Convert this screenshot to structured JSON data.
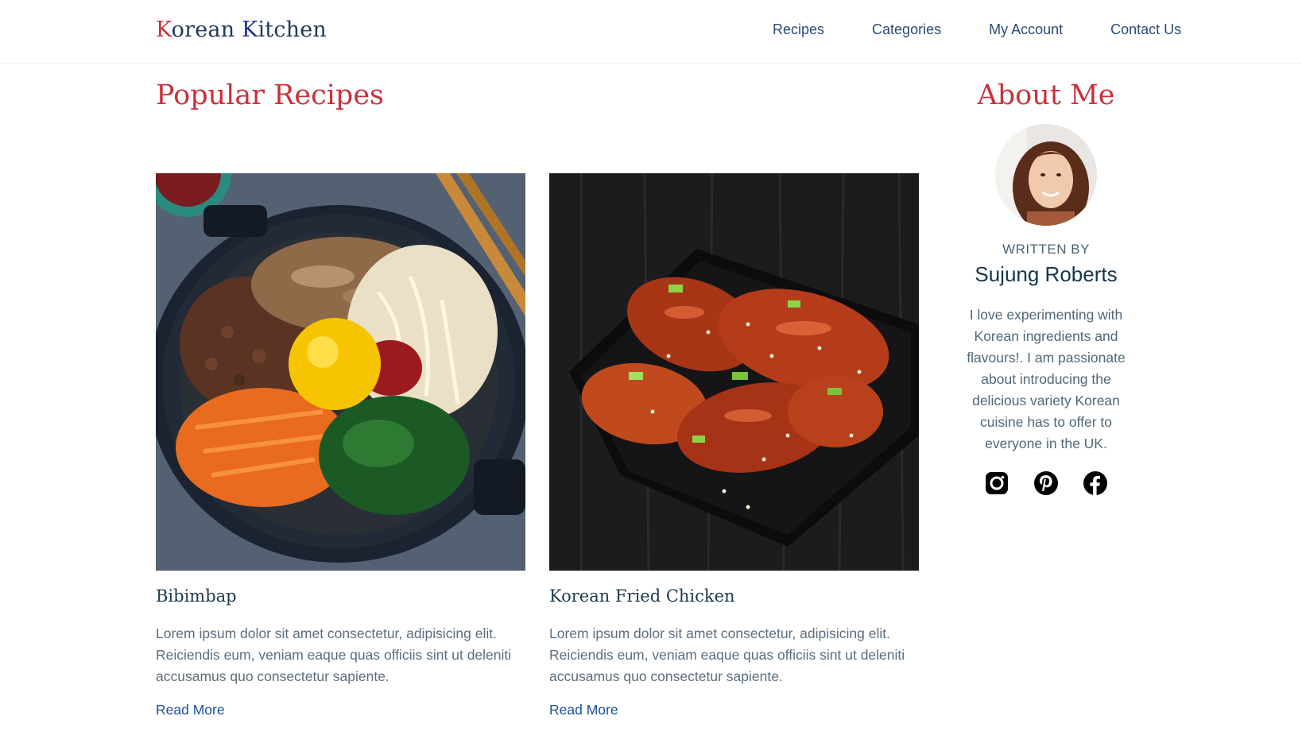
{
  "header": {
    "logo_k1": "K",
    "logo_part1": "orean ",
    "logo_k2": "K",
    "logo_part2": "itchen",
    "nav": [
      "Recipes",
      "Categories",
      "My Account",
      "Contact Us"
    ]
  },
  "main": {
    "section_title": "Popular Recipes",
    "recipes": [
      {
        "title": "Bibimbap",
        "description": "Lorem ipsum dolor sit amet consectetur, adipisicing elit. Reiciendis eum, veniam eaque quas officiis sint ut deleniti accusamus quo consectetur sapiente.",
        "link": "Read More",
        "image": "bibimbap-photo"
      },
      {
        "title": "Korean Fried Chicken",
        "description": "Lorem ipsum dolor sit amet consectetur, adipisicing elit. Reiciendis eum, veniam eaque quas officiis sint ut deleniti accusamus quo consectetur sapiente.",
        "link": "Read More",
        "image": "fried-chicken-photo"
      }
    ]
  },
  "sidebar": {
    "heading": "About Me",
    "written_by": "WRITTEN BY",
    "author": "Sujung Roberts",
    "bio": "I love experimenting with Korean ingredients and flavours!. I am passionate about introducing the delicious variety Korean cuisine has to offer to everyone in the UK.",
    "socials": [
      "instagram-icon",
      "pinterest-icon",
      "facebook-icon"
    ]
  },
  "colors": {
    "accent_red": "#c8323c",
    "logo_blue": "#1f2f8a",
    "nav_blue": "#2b4a7a",
    "link_blue": "#1f4f9a"
  }
}
